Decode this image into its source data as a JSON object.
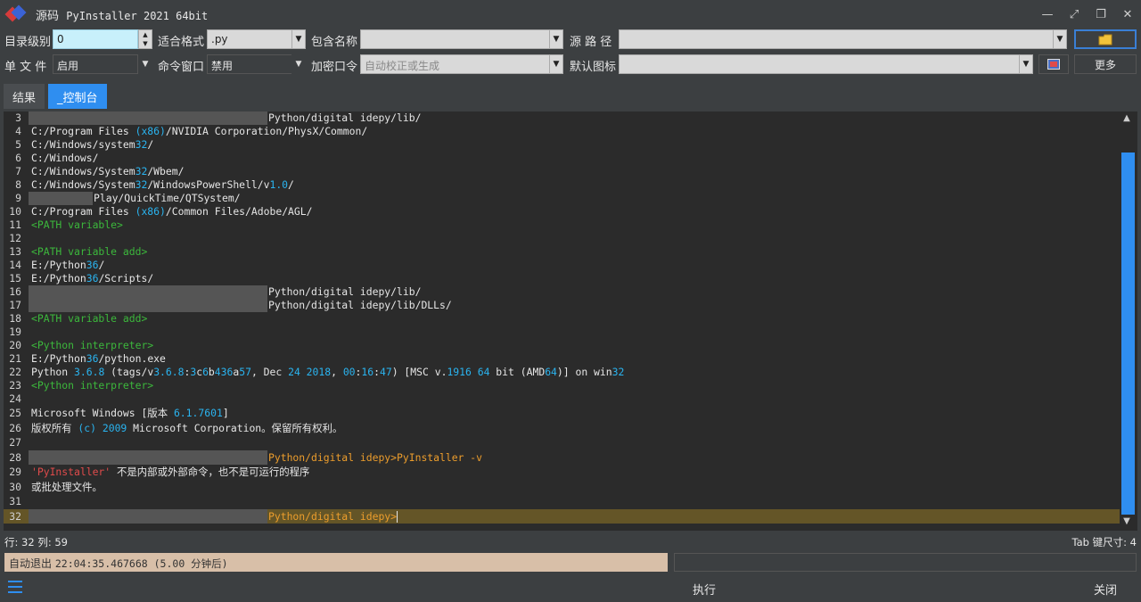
{
  "window": {
    "title_prefix": "源码",
    "title_app": "PyInstaller 2021 64bit"
  },
  "form": {
    "dir_level_label": "目录级别",
    "dir_level_value": "0",
    "format_label": "适合格式",
    "format_value": ".py",
    "include_label": "包含名称",
    "include_value": "",
    "source_label": "源 路 径",
    "source_value": "",
    "onefile_label": "单 文 件",
    "onefile_value": "启用",
    "console_label": "命令窗口",
    "console_value": "禁用",
    "key_label": "加密口令",
    "key_placeholder": "自动校正或生成",
    "icon_label": "默认图标",
    "icon_value": "",
    "more_label": "更多"
  },
  "tabs": [
    {
      "label": "结果",
      "active": false
    },
    {
      "label": "_控制台",
      "active": true
    }
  ],
  "console": {
    "lines": [
      {
        "n": "3",
        "t": "Python/digital idepy/lib/"
      },
      {
        "n": "4",
        "t": "C:/Program Files (x86)/NVIDIA Corporation/PhysX/Common/"
      },
      {
        "n": "5",
        "t": "C:/Windows/system32/"
      },
      {
        "n": "6",
        "t": "C:/Windows/"
      },
      {
        "n": "7",
        "t": "C:/Windows/System32/Wbem/"
      },
      {
        "n": "8",
        "t": "C:/Windows/System32/WindowsPowerShell/v1.0/"
      },
      {
        "n": "9",
        "t": "Play/QuickTime/QTSystem/"
      },
      {
        "n": "10",
        "t": "C:/Program Files (x86)/Common Files/Adobe/AGL/"
      },
      {
        "n": "11",
        "t": "<PATH variable>"
      },
      {
        "n": "12",
        "t": ""
      },
      {
        "n": "13",
        "t": "<PATH variable add>"
      },
      {
        "n": "14",
        "t": "E:/Python36/"
      },
      {
        "n": "15",
        "t": "E:/Python36/Scripts/"
      },
      {
        "n": "16",
        "t": "Python/digital idepy/lib/"
      },
      {
        "n": "17",
        "t": "Python/digital idepy/lib/DLLs/"
      },
      {
        "n": "18",
        "t": "<PATH variable add>"
      },
      {
        "n": "19",
        "t": ""
      },
      {
        "n": "20",
        "t": "<Python interpreter>"
      },
      {
        "n": "21",
        "t": "E:/Python36/python.exe"
      },
      {
        "n": "22",
        "t": "Python 3.6.8 (tags/v3.6.8:3c6b436a57, Dec 24 2018, 00:16:47) [MSC v.1916 64 bit (AMD64)] on win32"
      },
      {
        "n": "23",
        "t": "<Python interpreter>"
      },
      {
        "n": "24",
        "t": ""
      },
      {
        "n": "25",
        "t": "Microsoft Windows [版本 6.1.7601]"
      },
      {
        "n": "26",
        "t": "版权所有 (c) 2009 Microsoft Corporation。保留所有权利。"
      },
      {
        "n": "27",
        "t": ""
      },
      {
        "n": "28",
        "t": "Python/digital idepy>PyInstaller -v"
      },
      {
        "n": "29",
        "t": "'PyInstaller' 不是内部或外部命令，也不是可运行的程序"
      },
      {
        "n": "30",
        "t": "或批处理文件。"
      },
      {
        "n": "31",
        "t": ""
      },
      {
        "n": "32",
        "t": "Python/digital idepy>"
      }
    ]
  },
  "status": {
    "cursor_pos": "行: 32  列: 59",
    "tab_size": "Tab 键尺寸: 4"
  },
  "autoexit": {
    "label": "自动退出",
    "time": "22:04:35.467668 (5.00 分钟后)"
  },
  "bottom": {
    "execute_label": "执行",
    "close_label": "关闭"
  }
}
